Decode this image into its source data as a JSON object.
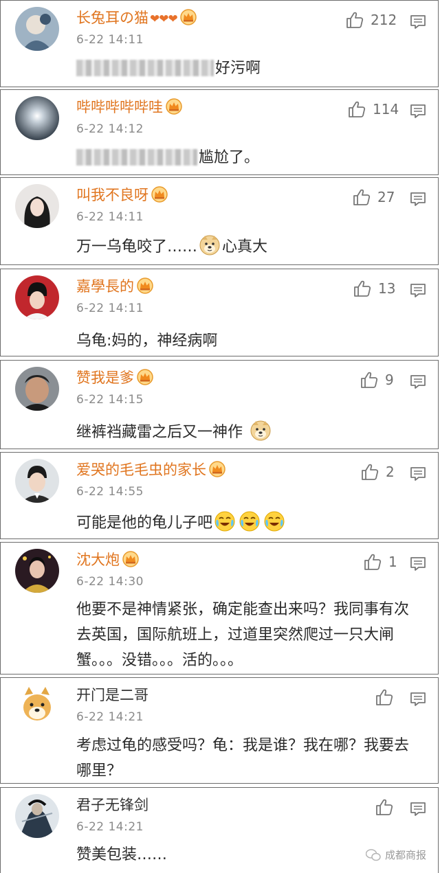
{
  "comments": [
    {
      "username": "长兔耳の猫",
      "hearts": "❤❤❤",
      "time": "6-22 14:11",
      "likes": "212",
      "text": "好污啊"
    },
    {
      "username": "哔哔哔哔哔哇",
      "time": "6-22 14:12",
      "likes": "114",
      "text": "尴尬了。"
    },
    {
      "username": "叫我不良呀",
      "time": "6-22 14:11",
      "likes": "27",
      "text_a": "万一乌龟咬了……",
      "text_b": "心真大"
    },
    {
      "username": "嘉學長的",
      "time": "6-22 14:11",
      "likes": "13",
      "text": "乌龟:妈的，神经病啊"
    },
    {
      "username": "赞我是爹",
      "time": "6-22 14:15",
      "likes": "9",
      "text": "继裤裆藏雷之后又一神作"
    },
    {
      "username": "爱哭的毛毛虫的家长",
      "time": "6-22 14:55",
      "likes": "2",
      "text": "可能是他的龟儿子吧"
    },
    {
      "username": "沈大炮",
      "time": "6-22 14:30",
      "likes": "1",
      "text": "他要不是神情紧张，确定能查出来吗？我同事有次去英国，国际航班上，过道里突然爬过一只大闸蟹。。。没错。。。活的。。。"
    },
    {
      "username": "开门是二哥",
      "time": "6-22 14:21",
      "likes": "",
      "text": "考虑过龟的感受吗？龟：我是谁？我在哪？我要去哪里？"
    },
    {
      "username": "君子无锋剑",
      "time": "6-22 14:21",
      "likes": "",
      "text": "赞美包装……"
    }
  ],
  "watermark": "成都商报",
  "colors": {
    "username": "#e0751f",
    "time": "#8a8a8a",
    "text": "#2a2a2a",
    "border": "#6b6b6b"
  }
}
